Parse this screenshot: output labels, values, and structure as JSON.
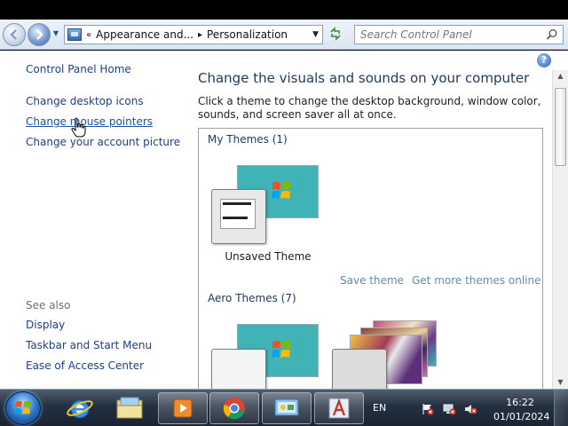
{
  "address": {
    "crumb_sep": "«",
    "crumbs": [
      "Appearance and...",
      "Personalization"
    ],
    "arrow": "▸"
  },
  "search": {
    "placeholder": "Search Control Panel"
  },
  "help": {
    "label": "?"
  },
  "sidebar": {
    "home": "Control Panel Home",
    "tasks": [
      "Change desktop icons",
      "Change mouse pointers",
      "Change your account picture"
    ],
    "see_also_title": "See also",
    "see_also": [
      "Display",
      "Taskbar and Start Menu",
      "Ease of Access Center"
    ]
  },
  "main": {
    "heading": "Change the visuals and sounds on your computer",
    "description": "Click a theme to change the desktop background, window color, sounds, and screen saver all at once.",
    "my_themes_title": "My Themes (1)",
    "unsaved_theme": "Unsaved Theme",
    "save_theme": "Save theme",
    "more_themes": "Get more themes online",
    "aero_title": "Aero Themes (7)"
  },
  "taskbar": {
    "language": "EN",
    "time": "16:22",
    "date": "01/01/2024"
  },
  "colors": {
    "link": "#1e3f8a",
    "heading": "#1e395b",
    "theme_teal": "#3fb3b5",
    "panel_link": "#5e8fa5"
  }
}
